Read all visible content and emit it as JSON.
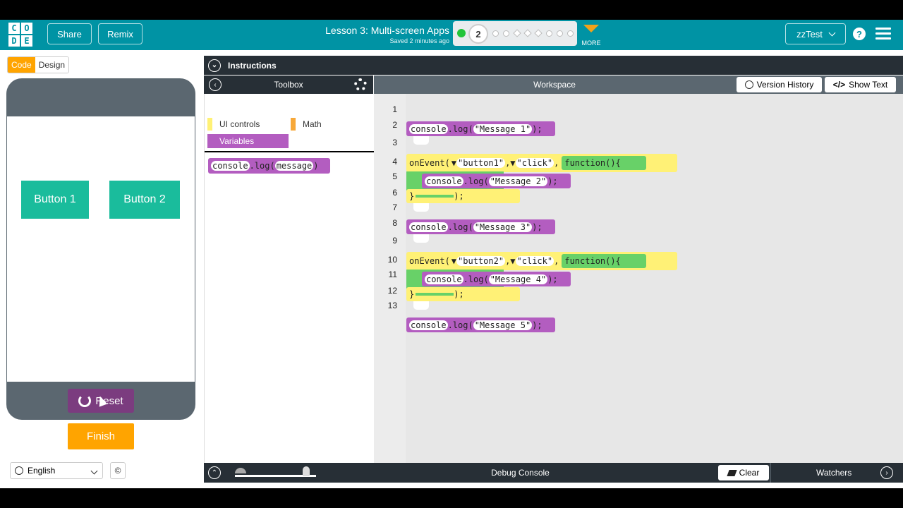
{
  "header": {
    "logo_letters": [
      "C",
      "O",
      "D",
      "E"
    ],
    "share_label": "Share",
    "remix_label": "Remix",
    "lesson_title": "Lesson 3: Multi-screen Apps",
    "saved_status": "Saved 2 minutes ago",
    "progress_current": "2",
    "more_label": "MORE",
    "user_name": "zzTest",
    "help_glyph": "?",
    "accent_color": "#0093a4",
    "more_color": "#f2a21a"
  },
  "left_panel": {
    "code_tab": "Code",
    "design_tab": "Design",
    "app_button_1": "Button 1",
    "app_button_2": "Button 2",
    "reset_label": "Reset",
    "finish_label": "Finish",
    "language": "English",
    "copyright_glyph": "©"
  },
  "instructions": {
    "title": "Instructions"
  },
  "toolbox": {
    "title": "Toolbox",
    "categories": [
      {
        "label": "UI controls",
        "color": "#fff176"
      },
      {
        "label": "Math",
        "color": "#f7a839"
      },
      {
        "label": "Variables",
        "color": "#b35dc0"
      }
    ],
    "block": {
      "object": "console",
      "method": ".log(",
      "arg": "message",
      "close": ")"
    }
  },
  "workspace": {
    "title": "Workspace",
    "version_history_label": "Version History",
    "show_text_label": "Show Text",
    "line_numbers": [
      "1",
      "2",
      "3",
      "4",
      "5",
      "6",
      "7",
      "8",
      "9",
      "10",
      "11",
      "12",
      "13"
    ],
    "code": {
      "log1": "\"Message 1\"",
      "event1_button": "\"button1\"",
      "event1_type": "\"click\"",
      "log2": "\"Message 2\"",
      "log3": "\"Message 3\"",
      "event2_button": "\"button2\"",
      "event2_type": "\"click\"",
      "log4": "\"Message 4\"",
      "log5": "\"Message 5\"",
      "console_kw": "console",
      "log_kw": ".log(",
      "log_close": ");",
      "on_event": "onEvent(",
      "function_kw": "function(){",
      "close_brace": "}",
      "close_call": ");",
      "dropdown_glyph": "▼",
      "comma": ","
    },
    "colors": {
      "variables": "#b35dc0",
      "ui_controls": "#fff176",
      "functions": "#68d168"
    }
  },
  "debug": {
    "title": "Debug Console",
    "clear_label": "Clear",
    "watchers_label": "Watchers"
  }
}
